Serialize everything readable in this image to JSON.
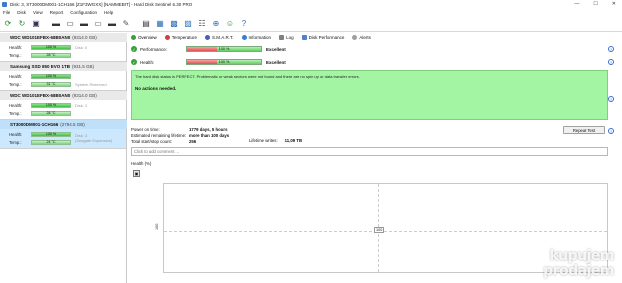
{
  "window": {
    "title": "Disk: 3, ST3000DM001-1CH166 [Z1F3WGXX]  [NAMMEBIT]  -  Hard Disk Sentinel 6.30 PRO",
    "minimize": "—",
    "maximize": "☐",
    "close": "✕"
  },
  "menu": [
    "File",
    "Disk",
    "View",
    "Report",
    "Configuration",
    "Help"
  ],
  "toolbar_icons": [
    "refresh-icon",
    "refresh-all-icon",
    "save-icon",
    "disk-icon",
    "disk-report-icon",
    "disk-test-icon",
    "disk-check-icon",
    "disk-surface-icon",
    "tools-icon",
    "acoustic-icon",
    "monitor-icon",
    "power-icon",
    "alerts-icon",
    "report-icon",
    "globe-icon",
    "users-icon",
    "settings-icon",
    "help-icon"
  ],
  "disks": [
    {
      "name": "WDC WD101EFBX-68B0AN0",
      "capacity": "(9314.0 GB)",
      "health_label": "Health:",
      "health": "100 %",
      "health_value": 1.0,
      "temp_label": "Temp.:",
      "temp": "28 °C",
      "side": "Disk: 0"
    },
    {
      "name": "Samsung SSD 850 EVO 1TB",
      "capacity": "(931.5 GB)",
      "health_label": "Health:",
      "health": "100 %",
      "health_value": 1.0,
      "temp_label": "Temp.:",
      "temp": "31 °C",
      "side": "System Reserved"
    },
    {
      "name": "WDC WD101EFBX-68B0AN0",
      "capacity": "(9314.0 GB)",
      "health_label": "Health:",
      "health": "100 %",
      "health_value": 1.0,
      "temp_label": "Temp.:",
      "temp": "28 °C",
      "side": "Disk: 2"
    },
    {
      "name": "ST3000DM001-1CH166",
      "capacity": "(2794.5 GB)",
      "health_label": "Health:",
      "health": "100 %",
      "health_value": 1.0,
      "temp_label": "Temp.:",
      "temp": "24 °C",
      "side": "Disk: 3\n(Seagate Expansion)"
    }
  ],
  "tabs": [
    {
      "label": "Overview",
      "color": "#3aa13a"
    },
    {
      "label": "Temperature",
      "color": "#d04040"
    },
    {
      "label": "S.M.A.R.T.",
      "color": "#4060c0"
    },
    {
      "label": "Information",
      "color": "#3a7bd5"
    },
    {
      "label": "Log",
      "color": "#808080"
    },
    {
      "label": "Disk Performance",
      "color": "#5080d0"
    },
    {
      "label": "Alerts",
      "color": "#a0a0a0"
    }
  ],
  "status": {
    "performance_label": "Performance:",
    "performance_value": "100 %",
    "performance_result": "Excellent",
    "health_label": "Health:",
    "health_value": "100 %",
    "health_result": "Excellent"
  },
  "message": {
    "text": "The hard disk status is PERFECT. Problematic or weak sectors were not found and there are no spin up or data transfer errors.",
    "actions": "No actions needed."
  },
  "info": {
    "power_on_label": "Power on time:",
    "power_on_value": "1779 days, 5 hours",
    "lifetime_label": "Estimated remaining lifetime:",
    "lifetime_value": "more than 100 days",
    "start_stop_label": "Total start/stop count:",
    "start_stop_value": "256",
    "writes_label": "Lifetime writes:",
    "writes_value": "11,09 TB",
    "repeat_button": "Repeat Test"
  },
  "comment": {
    "placeholder": "Click to add comment ..."
  },
  "health_chart": {
    "title": "Health (%)",
    "y_tick": "100",
    "point_label": "100"
  },
  "watermark": {
    "line1": "kupujem",
    "line2": "prodajem"
  },
  "colors": {
    "selected_disk": "#cce8ff",
    "status_green": "#a3f5a3",
    "bar_green": "#3fbf3f",
    "bar_red": "#e05050"
  }
}
